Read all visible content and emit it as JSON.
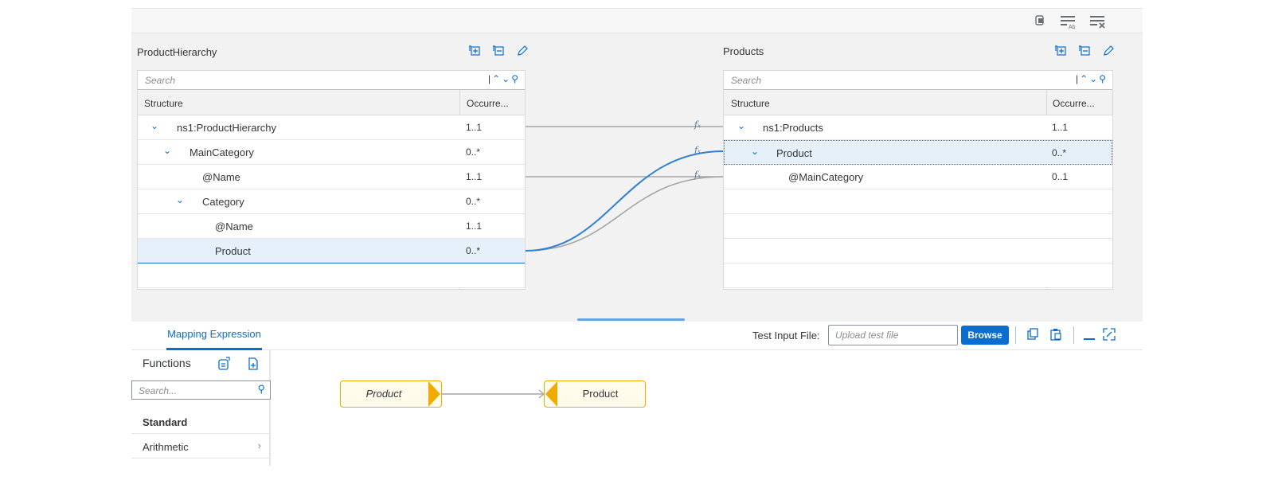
{
  "toolbar": {
    "icons": [
      "copy-icon",
      "text-format-icon",
      "clear-list-icon"
    ]
  },
  "source": {
    "title": "ProductHierarchy",
    "search_placeholder": "Search",
    "col_structure": "Structure",
    "col_occurrence": "Occurre...",
    "rows": [
      {
        "label": "ns1:ProductHierarchy",
        "occ": "1..1",
        "expanded": true
      },
      {
        "label": "MainCategory",
        "occ": "0..*",
        "expanded": true
      },
      {
        "label": "@Name",
        "occ": "1..1"
      },
      {
        "label": "Category",
        "occ": "0..*",
        "expanded": true
      },
      {
        "label": "@Name",
        "occ": "1..1"
      },
      {
        "label": "Product",
        "occ": "0..*",
        "selected": true
      }
    ]
  },
  "target": {
    "title": "Products",
    "search_placeholder": "Search",
    "col_structure": "Structure",
    "col_occurrence": "Occurre...",
    "rows": [
      {
        "label": "ns1:Products",
        "occ": "1..1",
        "expanded": true
      },
      {
        "label": "Product",
        "occ": "0..*",
        "expanded": true,
        "selected": true
      },
      {
        "label": "@MainCategory",
        "occ": "0..1"
      }
    ]
  },
  "mapping_fx": "fₓ",
  "bottom": {
    "tab_label": "Mapping Expression",
    "test_input_label": "Test Input File:",
    "upload_placeholder": "Upload test file",
    "browse_label": "Browse"
  },
  "functions": {
    "title": "Functions",
    "search_placeholder": "Search...",
    "group": "Standard",
    "item": "Arithmetic"
  },
  "expression": {
    "source_node": "Product",
    "target_node": "Product"
  },
  "colors": {
    "accent": "#0a6ed1",
    "node_border": "#f0ab00",
    "selection": "#e5f0fa"
  }
}
